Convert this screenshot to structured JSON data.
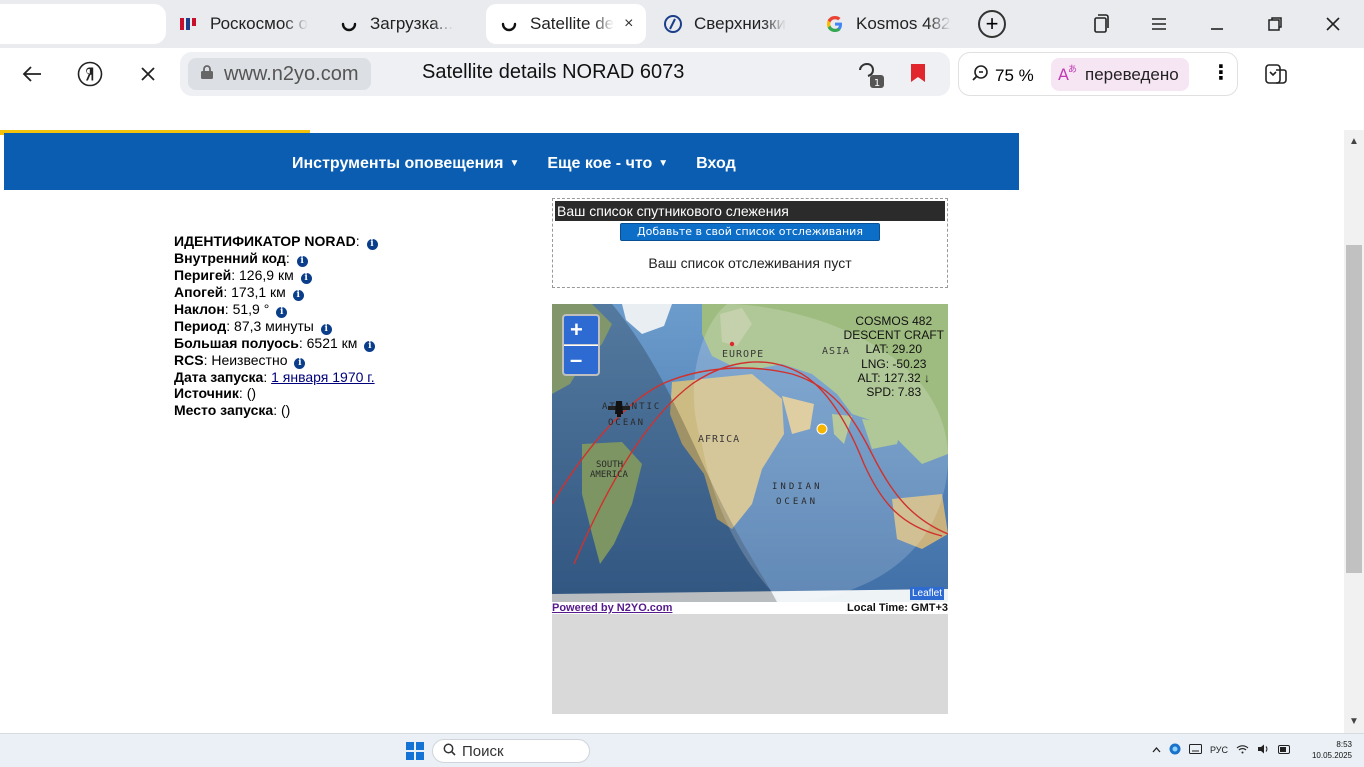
{
  "browser": {
    "tabs": [
      {
        "label": "Роскосмос о",
        "icon": "roscosmos-logo-icon"
      },
      {
        "label": "Загрузка...",
        "icon": "loading-spinner-icon"
      },
      {
        "label": "Satellite de",
        "icon": "loading-spinner-icon",
        "active": true
      },
      {
        "label": "Сверхнизки",
        "icon": "site-favicon-icon"
      },
      {
        "label": "Kosmos 482",
        "icon": "google-icon"
      }
    ],
    "tab_close": "×",
    "address": {
      "domain": "www.n2yo.com",
      "title": "Satellite details NORAD 6073"
    },
    "zoom": "75 %",
    "translated_label": "переведено",
    "extension_badge": "1"
  },
  "nav": {
    "items": [
      {
        "label": "Инструменты оповещения",
        "caret": true
      },
      {
        "label": "Еще кое - что",
        "caret": true
      },
      {
        "label": "Вход",
        "caret": false
      }
    ]
  },
  "satellite": {
    "rows": [
      {
        "label": "ИДЕНТИФИКАТОР NORAD",
        "value": ""
      },
      {
        "label": "Внутренний код",
        "value": ""
      },
      {
        "label": "Перигей",
        "value": "126,9 км"
      },
      {
        "label": "Апогей",
        "value": "173,1 км"
      },
      {
        "label": "Наклон",
        "value": "51,9 °"
      },
      {
        "label": "Период",
        "value": "87,3 минуты"
      },
      {
        "label": "Большая полуось",
        "value": "6521 км"
      },
      {
        "label": "RCS",
        "value": "Неизвестно"
      },
      {
        "label": "Дата запуска",
        "link": "1 января 1970 г."
      },
      {
        "label": "Источник",
        "value": "()"
      },
      {
        "label": "Место запуска",
        "value": "()"
      }
    ]
  },
  "watchlist": {
    "header": "Ваш список спутникового слежения",
    "add_button": "Добавьте в свой список отслеживания",
    "empty": "Ваш список отслеживания пуст"
  },
  "map": {
    "zoom_in": "+",
    "zoom_out": "–",
    "sat_name": "COSMOS 482",
    "sat_subtitle": "DESCENT CRAFT",
    "lat": "LAT: 29.20",
    "lng": "LNG: -50.23",
    "alt": "ALT: 127.32 ↓",
    "spd": "SPD: 7.83",
    "labels": {
      "europe": "EUROPE",
      "asia": "ASIA",
      "africa": "AFRICA",
      "atlantic": "ATLANTIC",
      "ocean1": "OCEAN",
      "south_america": "SOUTH",
      "south_america2": "AMERICA",
      "indian": "INDIAN",
      "ocean2": "OCEAN"
    },
    "attribution": "Leaflet",
    "powered": "Powered by N2YO.com",
    "local_time": "Local Time: GMT+3",
    "colors": {
      "track": "#d0312d",
      "water": "#4e7fb2",
      "land": "#8fb86e"
    }
  },
  "taskbar": {
    "search": "Поиск",
    "lang": "РУС",
    "time": "8:53",
    "date": "10.05.2025"
  }
}
